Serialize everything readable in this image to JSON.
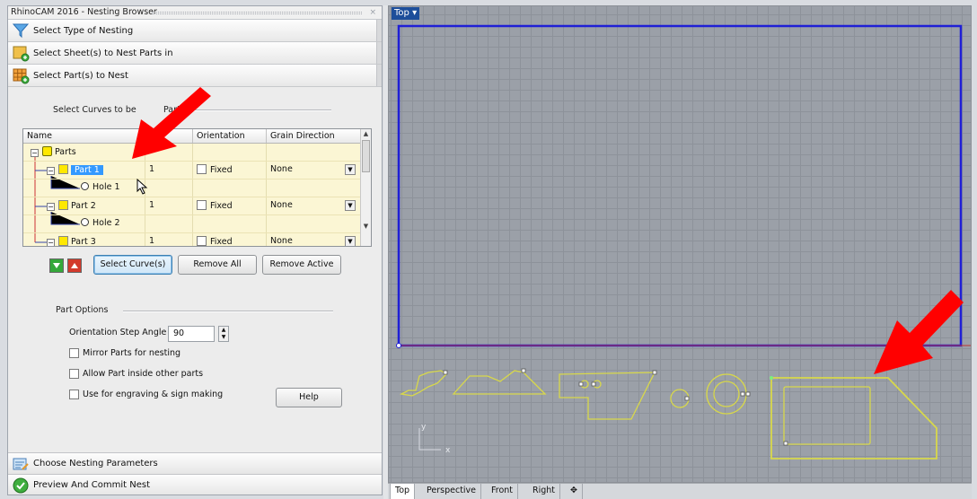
{
  "panel": {
    "title": "RhinoCAM 2016 - Nesting Browser",
    "close_glyph": "×",
    "sections": [
      {
        "label": "Select Type of Nesting",
        "icon": "funnel-icon"
      },
      {
        "label": "Select Sheet(s) to Nest Parts in",
        "icon": "sheet-icon"
      },
      {
        "label": "Select Part(s) to Nest",
        "icon": "parts-grid-icon"
      }
    ],
    "select_curves_group": "Select Curves to be",
    "select_curves_group_tail": "Parts",
    "table": {
      "headers": {
        "name": "Name",
        "orientation": "Orientation",
        "grain": "Grain Direction"
      },
      "rows": [
        {
          "kind": "root",
          "name": "Parts"
        },
        {
          "kind": "part",
          "name": "Part 1",
          "qty": "1",
          "fixed_label": "Fixed",
          "grain": "None",
          "selected": true
        },
        {
          "kind": "hole",
          "name": "Hole 1"
        },
        {
          "kind": "part",
          "name": "Part 2",
          "qty": "1",
          "fixed_label": "Fixed",
          "grain": "None",
          "selected": false
        },
        {
          "kind": "hole",
          "name": "Hole 2"
        },
        {
          "kind": "part",
          "name": "Part 3",
          "qty": "1",
          "fixed_label": "Fixed",
          "grain": "None",
          "selected": false
        }
      ]
    },
    "buttons": {
      "select_curves": "Select Curve(s)",
      "remove_all": "Remove All",
      "remove_active": "Remove Active",
      "help": "Help"
    },
    "part_options": {
      "title": "Part Options",
      "step_angle_label": "Orientation Step Angle",
      "step_angle_value": "90",
      "mirror_label": "Mirror Parts for nesting",
      "allow_inside_label": "Allow Part inside other parts",
      "engraving_label": "Use for engraving & sign making"
    },
    "footer": [
      {
        "label": "Choose Nesting Parameters",
        "icon": "parameters-icon"
      },
      {
        "label": "Preview And Commit Nest",
        "icon": "checkmark-icon"
      }
    ]
  },
  "viewport": {
    "label": "Top",
    "tabs": [
      "Top",
      "Perspective",
      "Front",
      "Right"
    ],
    "axis_y": "y",
    "axis_x": "x",
    "colors": {
      "sheet": "#1f1fd6",
      "parts": "#d8d84a",
      "arrow": "#ff0000",
      "grid": "#9ba0a8"
    }
  }
}
